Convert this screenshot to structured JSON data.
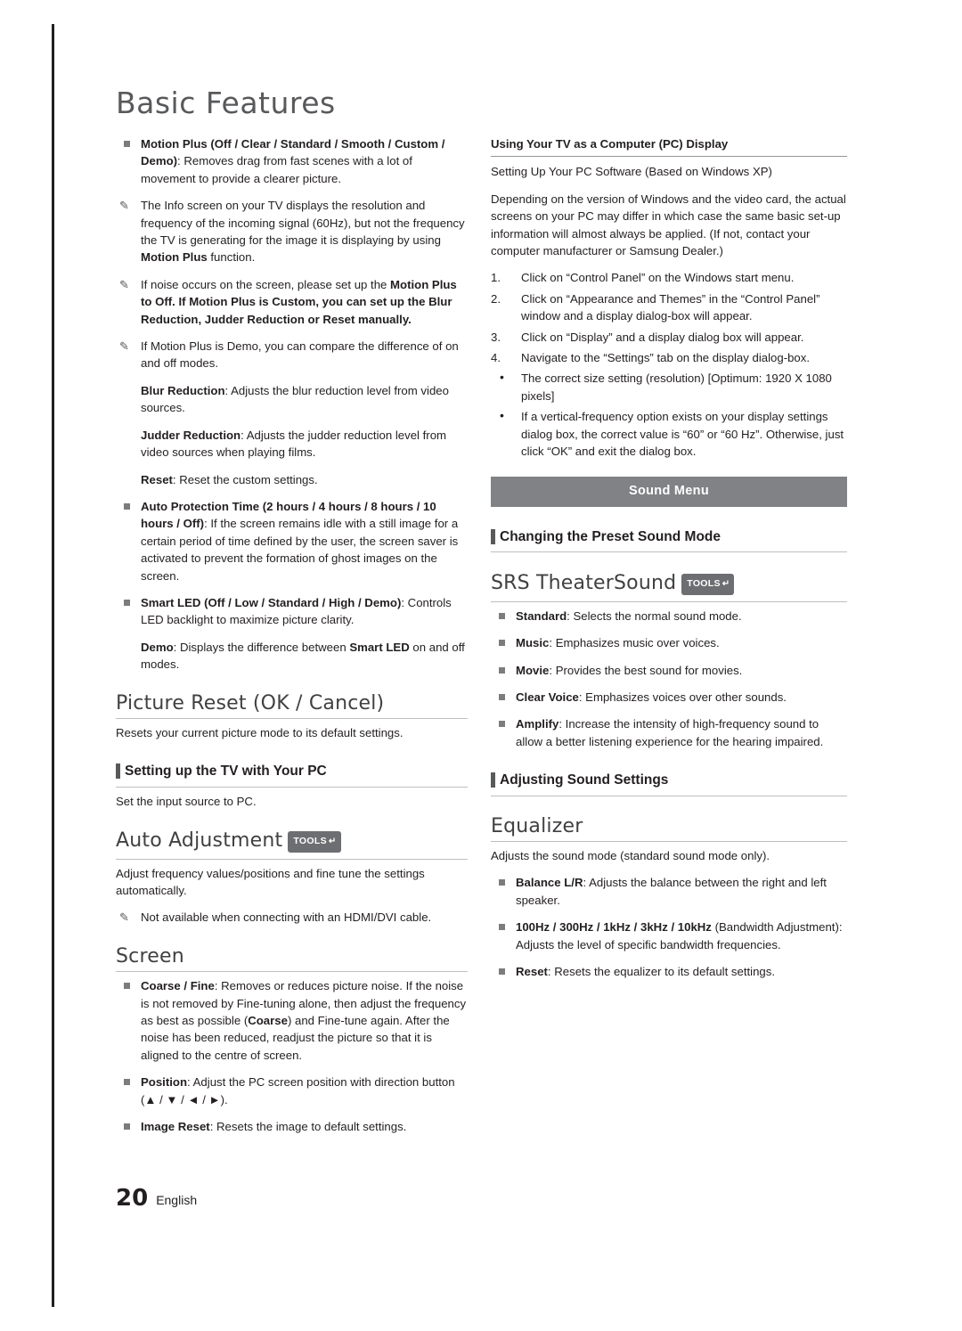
{
  "page": {
    "title": "Basic Features",
    "number": "20",
    "language": "English"
  },
  "left_column": {
    "motion_plus": {
      "bold_head": "Motion Plus (Off / Clear / Standard / Smooth / Custom / Demo)",
      "rest": ": Removes drag from fast scenes with a lot of movement to provide a clearer picture."
    },
    "notes": [
      {
        "glyph": "note-icon",
        "text": "The Info screen on your TV displays the resolution and frequency of the incoming signal (60Hz), but not the frequency the TV is generating for the image it is displaying by using ",
        "bold": "Motion Plus",
        "tail": " function."
      },
      {
        "glyph": "note-icon",
        "text": "If noise occurs on the screen, please set up the ",
        "segments": "Motion Plus to Off. If Motion Plus is Custom, you can set up the Blur Reduction, Judder Reduction or Reset manually."
      },
      {
        "glyph": "note-icon",
        "text": "If Motion Plus is Demo, you can compare the difference of on and off modes."
      }
    ],
    "blur_reduction": {
      "bold": "Blur Reduction",
      "rest": ": Adjusts the blur reduction level from video sources."
    },
    "judder_reduction": {
      "bold": "Judder Reduction",
      "rest": ": Adjusts the judder reduction level from video sources when playing films."
    },
    "reset": {
      "bold": "Reset",
      "rest": ": Reset the custom settings."
    },
    "auto_protection": {
      "bold": "Auto Protection Time (2 hours / 4 hours / 8 hours / 10 hours / Off)",
      "rest": ":  If the screen remains idle with a still image for a certain period of time defined by the user, the screen saver is activated to prevent the formation of ghost images on the screen."
    },
    "smart_led": {
      "bold": "Smart LED (Off / Low / Standard / High / Demo)",
      "rest": ": Controls LED backlight to maximize picture clarity."
    },
    "demo": {
      "bold": "Demo",
      "rest": ": Displays the difference between ",
      "bold2": "Smart LED",
      "tail": " on and off modes."
    },
    "picture_reset_heading": "Picture Reset (OK / Cancel)",
    "picture_reset_body": "Resets your current picture mode to its default settings.",
    "setting_up_tv_heading": "Setting up the TV with Your PC",
    "setting_up_tv_body": "Set the input source to PC.",
    "auto_adjustment_heading": "Auto Adjustment",
    "auto_adjustment_tools": "TOOLS",
    "auto_adjustment_body": "Adjust frequency values/positions and fine tune the settings automatically.",
    "auto_adjustment_note": "Not available when connecting with an HDMI/DVI cable.",
    "screen_heading": "Screen",
    "coarse_fine": {
      "bold": "Coarse / Fine",
      "rest": ": Removes or reduces picture noise. If the noise is not removed by Fine-tuning alone, then adjust the frequency as best as possible (",
      "bold2": "Coarse",
      "tail": ") and Fine-tune again. After the noise has been reduced, readjust the picture so that it is aligned to the centre of screen."
    },
    "position": {
      "bold": "Position",
      "rest": ": Adjust the PC screen position with direction button (▲ / ▼ / ◄ / ►)."
    },
    "image_reset": {
      "bold": "Image Reset",
      "rest": ": Resets the image to default settings."
    }
  },
  "right_column": {
    "pc_display_title": "Using Your TV as a Computer (PC) Display",
    "pc_setup_title": "Setting Up Your PC Software (Based on Windows XP)",
    "pc_intro": "Depending on the version of Windows and the video card, the actual screens on your PC may differ in which case the same basic set-up information will almost always be applied. (If not, contact your computer manufacturer or Samsung Dealer.)",
    "steps": [
      {
        "n": "1.",
        "text": "Click on “Control Panel” on the Windows start menu."
      },
      {
        "n": "2.",
        "text": "Click on “Appearance and Themes” in the “Control Panel” window and a display dialog-box will appear."
      },
      {
        "n": "3.",
        "text": "Click on “Display” and a display dialog box will appear."
      },
      {
        "n": "4.",
        "text": "Navigate to the “Settings” tab on the display dialog-box."
      }
    ],
    "bullets": [
      "The correct size setting (resolution) [Optimum: 1920 X 1080 pixels]",
      "If a vertical-frequency option exists on your display settings dialog box, the correct value is “60” or “60 Hz”. Otherwise, just click “OK” and exit the dialog box."
    ],
    "sound_menu_band": "Sound Menu",
    "changing_preset_heading": "Changing the Preset Sound Mode",
    "srs_heading": "SRS TheaterSound",
    "srs_tools": "TOOLS",
    "sound_modes": [
      {
        "bold": "Standard",
        "rest": ": Selects the normal sound mode."
      },
      {
        "bold": "Music",
        "rest": ": Emphasizes music over voices."
      },
      {
        "bold": "Movie",
        "rest": ": Provides the best sound for movies."
      },
      {
        "bold": "Clear Voice",
        "rest": ": Emphasizes voices over other sounds."
      },
      {
        "bold": "Amplify",
        "rest": ": Increase the intensity of high-frequency sound to allow a better listening experience for the hearing impaired."
      }
    ],
    "adjusting_sound_heading": "Adjusting Sound Settings",
    "equalizer_heading": "Equalizer",
    "equalizer_body": "Adjusts the sound mode (standard sound mode only).",
    "equalizer_items": [
      {
        "bold": "Balance L/R",
        "rest": ": Adjusts the balance between the right and left speaker."
      },
      {
        "bold": "100Hz / 300Hz / 1kHz / 3kHz / 10kHz",
        "rest": " (Bandwidth Adjustment): Adjusts the level of specific bandwidth frequencies."
      },
      {
        "bold": "Reset",
        "rest": ": Resets the equalizer to its default settings."
      }
    ]
  }
}
